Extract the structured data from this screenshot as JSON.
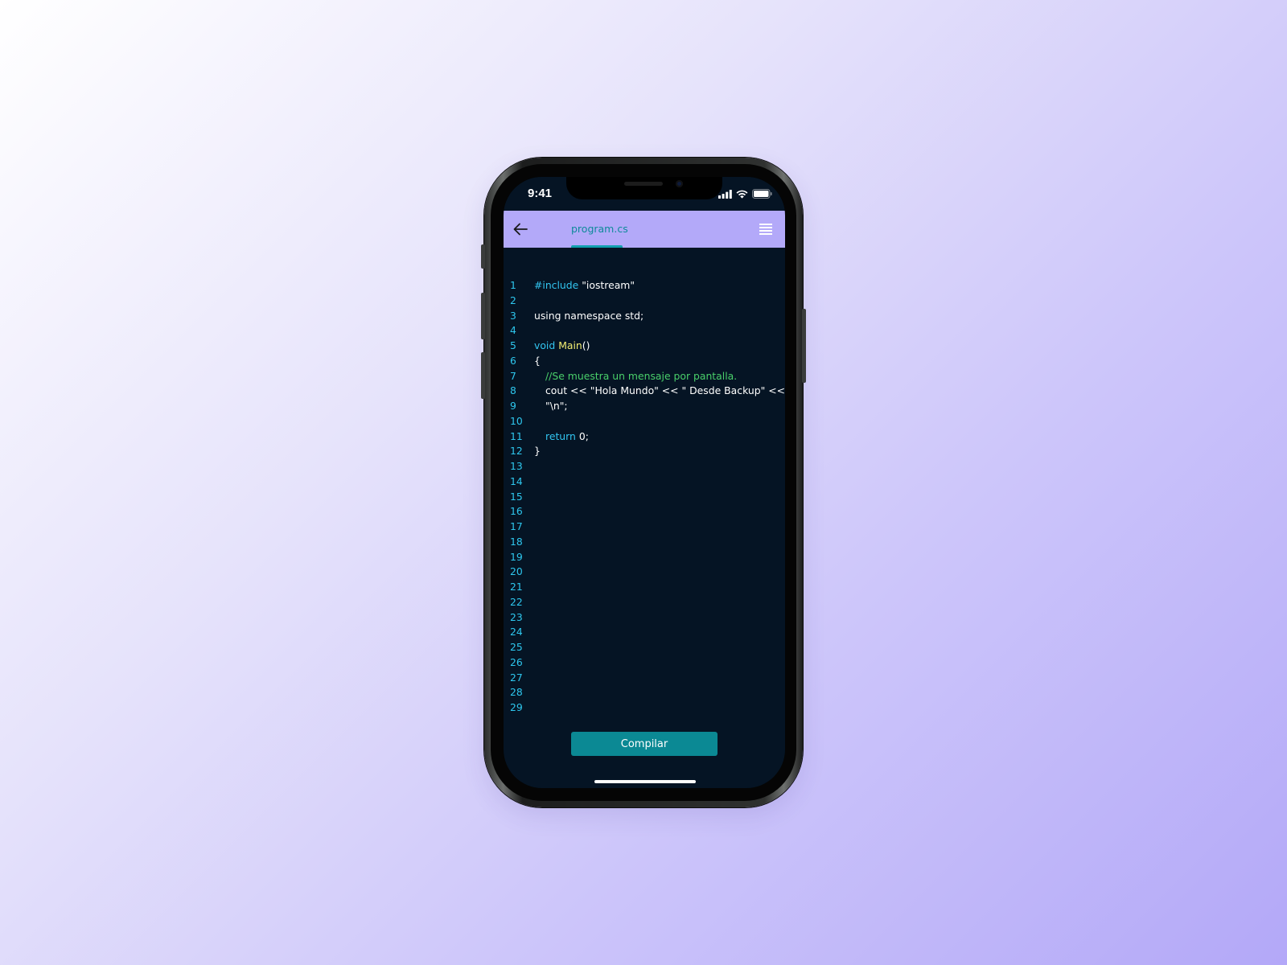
{
  "status_bar": {
    "time": "9:41",
    "icons": [
      "signal-icon",
      "wifi-icon",
      "battery-icon"
    ]
  },
  "app_bar": {
    "back_icon": "arrow-left-icon",
    "tab_label": "program.cs",
    "menu_icon": "hamburger-menu-icon"
  },
  "colors": {
    "background_gradient_start": "#ffffff",
    "background_gradient_end": "#b3a8f8",
    "app_bar": "#b3a9f9",
    "editor_bg": "#051424",
    "line_number": "#2ec7ee",
    "keyword": "#32c5f0",
    "function": "#f4ee72",
    "comment": "#49cf6a",
    "button": "#0b8994"
  },
  "editor": {
    "line_numbers": [
      "1",
      "2",
      "3",
      "4",
      "5",
      "6",
      "7",
      "8",
      "9",
      "10",
      "11",
      "12",
      "13",
      "14",
      "15",
      "16",
      "17",
      "18",
      "19",
      "20",
      "21",
      "22",
      "23",
      "24",
      "25",
      "26",
      "27",
      "28",
      "29"
    ],
    "code": {
      "l1_kw": "#include",
      "l1_text": " \"iostream\"",
      "l3_text": "using namespace std;",
      "l5_kw": "void",
      "l5_fn": "Main",
      "l5_text": "()",
      "l6_text": "{",
      "l7_comment": "//Se muestra un mensaje por pantalla.",
      "l8_text": "cout << \"Hola Mundo\" << \" Desde Backup\" <<",
      "l9_text": "\"\\n\";",
      "l11_kw": "return",
      "l11_text": " 0;",
      "l12_text": "}"
    }
  },
  "compile_button": {
    "label": "Compilar"
  }
}
